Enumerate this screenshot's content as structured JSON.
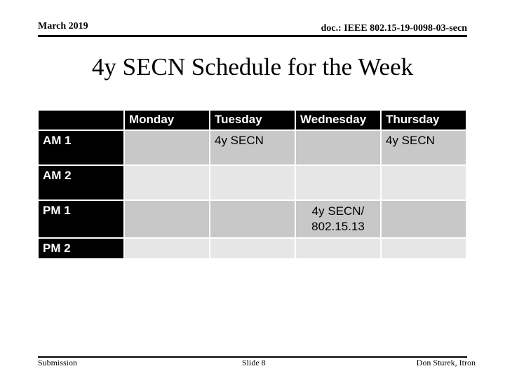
{
  "header": {
    "date": "March 2019",
    "doc_id": "doc.: IEEE 802.15-19-0098-03-secn"
  },
  "slide": {
    "title": "4y SECN Schedule for the Week"
  },
  "schedule": {
    "columns": [
      "",
      "Monday",
      "Tuesday",
      "Wednesday",
      "Thursday"
    ],
    "rows": [
      {
        "label": "AM 1",
        "cells": [
          "",
          "4y SECN",
          "",
          "4y SECN"
        ]
      },
      {
        "label": "AM 2",
        "cells": [
          "",
          "",
          "",
          ""
        ]
      },
      {
        "label": "PM 1",
        "cells": [
          "",
          "",
          "4y SECN/\n802.15.13",
          ""
        ]
      },
      {
        "label": "PM 2",
        "cells": [
          "",
          "",
          "",
          ""
        ]
      }
    ]
  },
  "footer": {
    "left": "Submission",
    "center": "Slide 8",
    "right": "Don Sturek, Itron"
  }
}
